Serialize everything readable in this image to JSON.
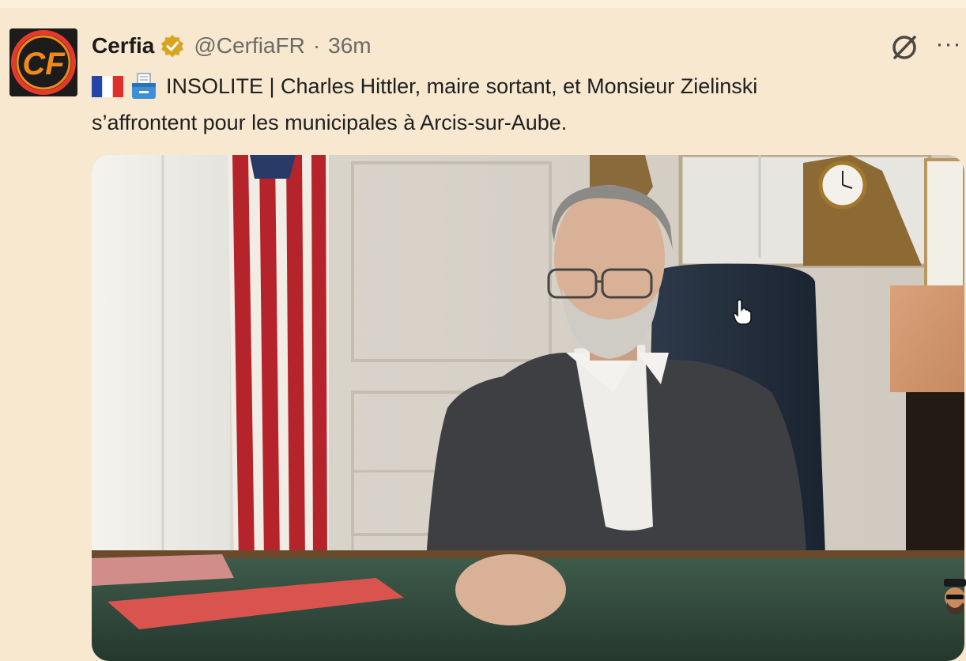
{
  "account": {
    "name": "Cerfia",
    "handle": "@CerfiaFR",
    "separator": "·",
    "time": "36m",
    "logo_text": "CF",
    "verified": true
  },
  "tweet": {
    "line1": "INSOLITE | Charles Hittler, maire sortant, et Monsieur Zielinski",
    "line2": "s’affrontent pour les municipales à Arcis-sur-Aube.",
    "leading_emojis": [
      "flag-france-icon",
      "ballot-box-icon"
    ]
  },
  "actions": {
    "more_label": "···",
    "grok_icon": "grok-icon"
  },
  "media": {
    "type": "photo",
    "clock_display": "analog"
  },
  "colors": {
    "background": "#f7e8cf",
    "text": "#1f1f1f",
    "muted": "#6d6a66",
    "badge_gold": "#d9a520",
    "logo_orange": "#f08a1c"
  }
}
